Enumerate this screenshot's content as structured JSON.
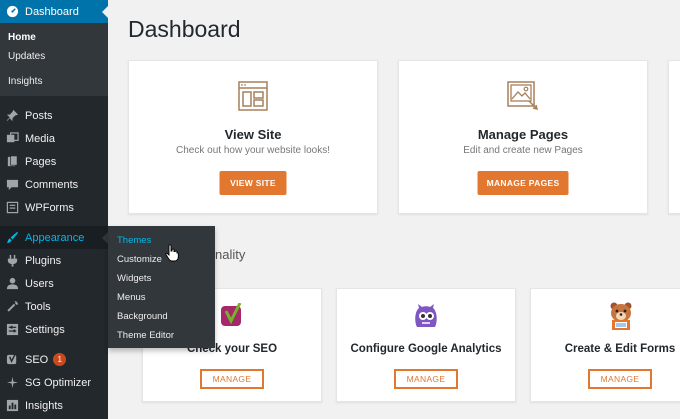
{
  "sidebar": {
    "dashboard": "Dashboard",
    "home": "Home",
    "updates": "Updates",
    "insights_sub": "Insights",
    "posts": "Posts",
    "media": "Media",
    "pages": "Pages",
    "comments": "Comments",
    "wpforms": "WPForms",
    "appearance": "Appearance",
    "plugins": "Plugins",
    "users": "Users",
    "tools": "Tools",
    "settings": "Settings",
    "seo": "SEO",
    "seo_badge": "1",
    "sg_optimizer": "SG Optimizer",
    "insights": "Insights"
  },
  "flyout": {
    "themes": "Themes",
    "customize": "Customize",
    "widgets": "Widgets",
    "menus": "Menus",
    "background": "Background",
    "theme_editor": "Theme Editor"
  },
  "main": {
    "page_title": "Dashboard",
    "cards_top": [
      {
        "title": "View Site",
        "subtitle": "Check out how your website looks!",
        "button": "VIEW SITE",
        "icon": "browser-layout-icon"
      },
      {
        "title": "Manage Pages",
        "subtitle": "Edit and create new Pages",
        "button": "MANAGE PAGES",
        "icon": "image-page-icon"
      }
    ],
    "section_label": "nality",
    "cards_bottom": [
      {
        "title": "Check your SEO",
        "button": "MANAGE",
        "icon": "yoast-seo-icon"
      },
      {
        "title": "Configure Google Analytics",
        "button": "MANAGE",
        "icon": "monsterinsights-icon"
      },
      {
        "title": "Create & Edit Forms",
        "button": "MANAGE",
        "icon": "wpforms-bear-icon"
      }
    ]
  },
  "colors": {
    "sidebar_bg": "#23282d",
    "active_bg": "#0073aa",
    "accent_orange": "#e27730",
    "highlight_blue": "#00b9eb"
  }
}
